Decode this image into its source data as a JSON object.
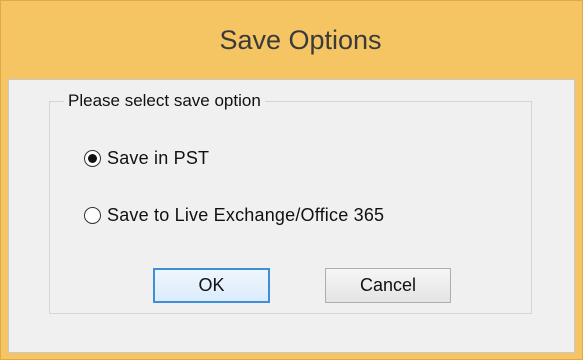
{
  "window": {
    "title": "Save Options",
    "titlebar_color": "#f5c463"
  },
  "group": {
    "legend": "Please select save option",
    "options": [
      {
        "label": "Save in PST",
        "selected": true
      },
      {
        "label": "Save to Live Exchange/Office 365",
        "selected": false
      }
    ]
  },
  "buttons": {
    "ok_label": "OK",
    "cancel_label": "Cancel"
  },
  "colors": {
    "focus_border": "#3c8fd8",
    "client_background": "#f0f0f0"
  }
}
